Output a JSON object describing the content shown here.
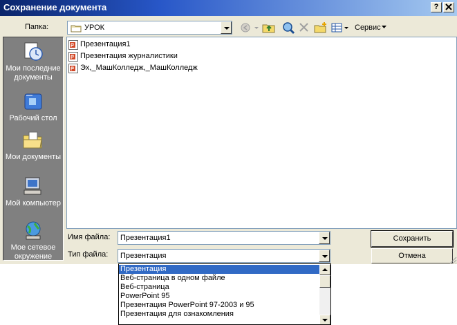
{
  "window": {
    "title": "Сохранение документа",
    "help_label": "?",
    "close_label": "X",
    "title_gradient": [
      "#0a246a",
      "#a6caf0"
    ]
  },
  "location": {
    "label": "Папка:",
    "value": "УРОК"
  },
  "toolbar": {
    "icons": [
      "back-icon",
      "up-folder-icon",
      "web-search-icon",
      "delete-icon",
      "new-folder-icon",
      "views-icon"
    ],
    "service_label": "Сервис"
  },
  "places": [
    {
      "label": "Мои последние документы",
      "icon": "recent-documents-icon"
    },
    {
      "label": "Рабочий стол",
      "icon": "desktop-icon"
    },
    {
      "label": "Мои документы",
      "icon": "my-documents-icon"
    },
    {
      "label": "Мой компьютер",
      "icon": "my-computer-icon"
    },
    {
      "label": "Мое сетевое окружение",
      "icon": "network-places-icon"
    }
  ],
  "files": [
    {
      "name": "Презентация1",
      "icon": "powerpoint-file-icon"
    },
    {
      "name": "Презентация журналистики",
      "icon": "powerpoint-file-icon"
    },
    {
      "name": "Эх,_МашКолледж,_МашКолледж",
      "icon": "powerpoint-file-icon"
    }
  ],
  "filename": {
    "label": "Имя файла:",
    "value": "Презентация1"
  },
  "filetype": {
    "label": "Тип файла:",
    "value": "Презентация",
    "options": [
      "Презентация",
      "Веб-страница в одном файле",
      "Веб-страница",
      "PowerPoint 95",
      "Презентация PowerPoint 97-2003 и 95",
      "Презентация для ознакомления"
    ],
    "selected_index": 0
  },
  "buttons": {
    "save": "Сохранить",
    "cancel": "Отмена"
  },
  "colors": {
    "dialog_bg": "#ece9d8",
    "selection": "#316ac5",
    "places_bg": "#808080"
  }
}
